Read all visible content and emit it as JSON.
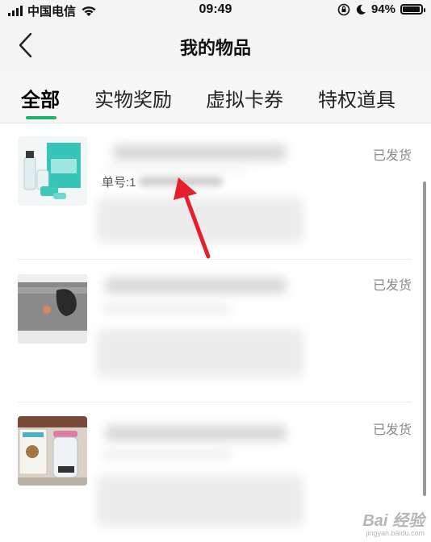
{
  "status_bar": {
    "carrier": "中国电信",
    "time": "09:49",
    "battery": "94%",
    "battery_level": 0.94,
    "icons": [
      "signal-icon",
      "wifi-icon",
      "orientation-lock-icon",
      "moon-icon",
      "battery-icon"
    ]
  },
  "nav": {
    "back_icon": "chevron-left-icon",
    "title": "我的物品"
  },
  "tabs": [
    {
      "label": "全部",
      "active": true
    },
    {
      "label": "实物奖励",
      "active": false
    },
    {
      "label": "虚拟卡券",
      "active": false
    },
    {
      "label": "特权道具",
      "active": false
    }
  ],
  "orders": [
    {
      "status": "已发货",
      "order_no_label": "单号:1"
    },
    {
      "status": "已发货"
    },
    {
      "status": "已发货"
    }
  ],
  "watermark": {
    "logo": "Bai 经验",
    "sub": "jingyan.baidu.com"
  },
  "colors": {
    "accent": "#19b46b",
    "annotation": "#e5202b",
    "header_bg": "#f4f4f4",
    "status_text": "#8a8a8a"
  }
}
